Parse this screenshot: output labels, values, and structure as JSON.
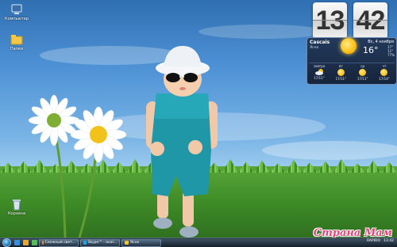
{
  "desktop": {
    "icons": [
      {
        "label": "Компьютер",
        "icon": "computer-icon"
      },
      {
        "label": "Папки",
        "icon": "folder-icon"
      },
      {
        "label": "Корзина",
        "icon": "recycle-bin-icon"
      }
    ]
  },
  "clock": {
    "hours": "13",
    "minutes": "42"
  },
  "weather": {
    "city": "Cascais",
    "condition": "Ясно",
    "date": "Вс, 4 ноября",
    "temperature": "16°",
    "details": [
      "17°",
      "11°",
      "77%"
    ],
    "forecast": [
      {
        "day": "завтра",
        "temps": "17/11°",
        "icon": "partly-cloudy-icon"
      },
      {
        "day": "вт",
        "temps": "17/11°",
        "icon": "sun-icon"
      },
      {
        "day": "ср",
        "temps": "17/11°",
        "icon": "sun-icon"
      },
      {
        "day": "чт",
        "temps": "17/14°",
        "icon": "sun-icon"
      }
    ]
  },
  "taskbar": {
    "buttons": [
      {
        "label": "Сложный свет...",
        "icon": "browser-icon"
      },
      {
        "label": "Skype™ - aval...",
        "icon": "skype-icon"
      },
      {
        "label": "Ясно",
        "icon": "gadget-icon"
      }
    ],
    "tray_lang": "RAPIDO",
    "time": "13:42"
  },
  "watermark": "Страна Мам",
  "colors": {
    "accent": "#e8447c",
    "sky": "#4f93d6",
    "grass": "#3f8e28"
  }
}
